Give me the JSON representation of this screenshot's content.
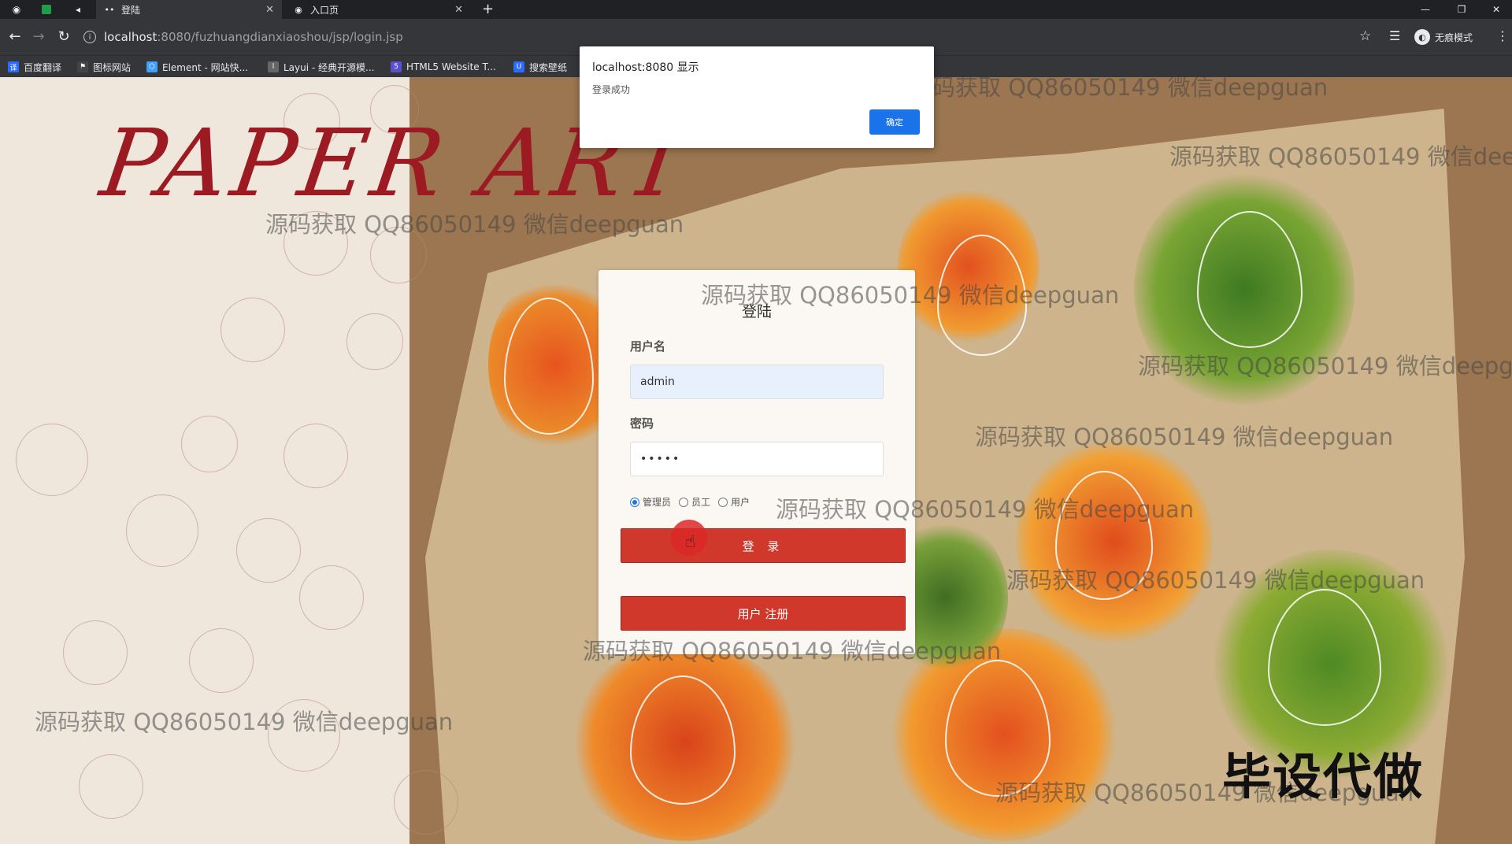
{
  "tabs": [
    {
      "label": "登陆",
      "active": true
    },
    {
      "label": "入口页",
      "active": false
    }
  ],
  "address": {
    "host": "localhost",
    "path": ":8080/fuzhuangdianxiaoshou/jsp/login.jsp"
  },
  "profile": {
    "label": "无痕模式"
  },
  "bookmarks": [
    {
      "label": "百度翻译",
      "icon": "translate-icon",
      "color": "#2d6bff"
    },
    {
      "label": "图标网站",
      "icon": "flag-icon",
      "color": "#444"
    },
    {
      "label": "Element - 网站快...",
      "icon": "element-icon",
      "color": "#409eff"
    },
    {
      "label": "Layui - 经典开源模...",
      "icon": "layui-icon",
      "color": "#666"
    },
    {
      "label": "HTML5 Website T...",
      "icon": "html5-icon",
      "color": "#5b4fd1"
    },
    {
      "label": "搜索壁纸",
      "icon": "wallpaper-icon",
      "color": "#2d6bff"
    }
  ],
  "hero": {
    "title": "PAPER ART"
  },
  "login": {
    "title": "登陆",
    "username_label": "用户名",
    "username_value": "admin",
    "password_label": "密码",
    "password_value": "•••••",
    "roles": [
      "管理员",
      "员工",
      "用户"
    ],
    "selected_role": "管理员",
    "login_button": "登 录",
    "register_button": "用户 注册"
  },
  "dialog": {
    "title": "localhost:8080 显示",
    "message": "登录成功",
    "ok_button": "确定"
  },
  "watermark": {
    "text": "源码获取 QQ86050149 微信deepguan"
  },
  "stamp": {
    "text": "毕设代做"
  },
  "colors": {
    "accent": "#d0382c",
    "dialog_button": "#1a73e8",
    "brand_text": "#9c1b22"
  }
}
